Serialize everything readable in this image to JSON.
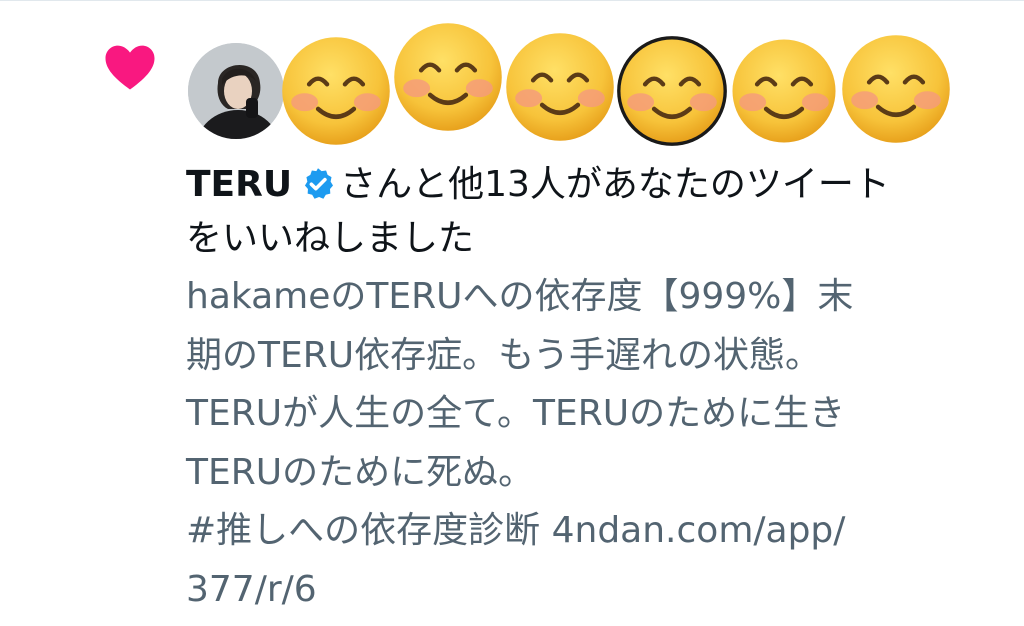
{
  "notification": {
    "name": "TERU",
    "message_line1": "さんと他13人があなたのツイート",
    "message_line2": "をいいねしました",
    "icon": "heart-icon",
    "verified_icon": "verified-badge-icon"
  },
  "avatars": [
    {
      "type": "photo",
      "alt": "avatar"
    },
    {
      "type": "emoji",
      "icon": "smiling-face-icon"
    },
    {
      "type": "emoji",
      "icon": "smiling-face-icon"
    },
    {
      "type": "emoji",
      "icon": "smiling-face-icon"
    },
    {
      "type": "emoji",
      "icon": "smiling-face-icon"
    },
    {
      "type": "emoji",
      "icon": "smiling-face-icon"
    },
    {
      "type": "emoji",
      "icon": "smiling-face-icon"
    }
  ],
  "tweet": {
    "lines": [
      "hakameのTERUへの依存度【999%】末",
      "期のTERU依存症。もう手遅れの状態。",
      "TERUが人生の全て。TERUのために生き",
      "TERUのために死ぬ。",
      "#推しへの依存度診断 4ndan.com/app/",
      "377/r/6"
    ]
  },
  "colors": {
    "heart": "#f91880",
    "verified": "#1d9bf0",
    "primary_text": "#0f1419",
    "secondary_text": "#536471",
    "emoji_face": "#f7c33a"
  }
}
